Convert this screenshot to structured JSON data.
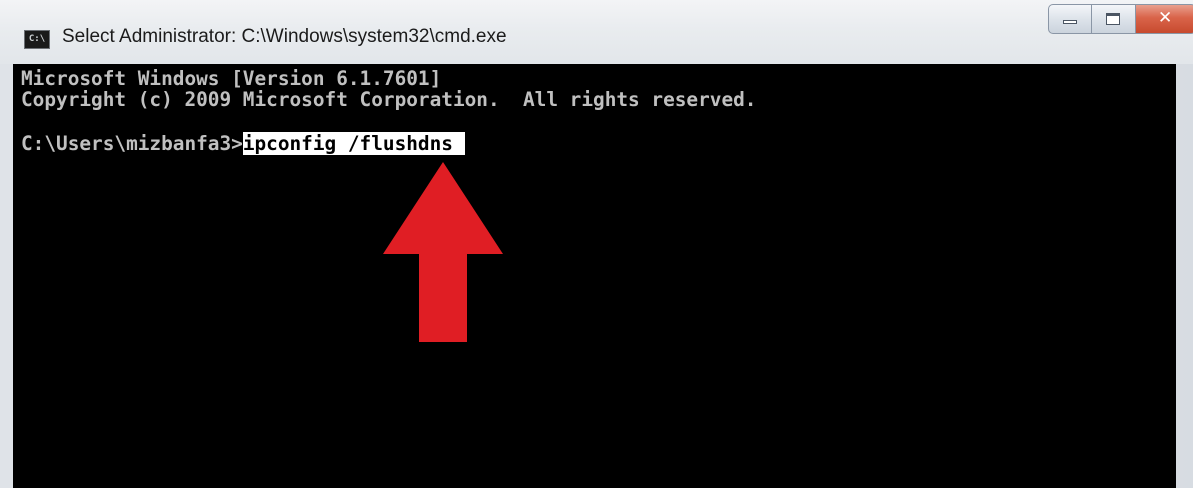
{
  "window": {
    "title": "Select Administrator: C:\\Windows\\system32\\cmd.exe",
    "app_icon": "cmd-icon",
    "app_icon_text": "C:\\"
  },
  "caption_buttons": {
    "minimize": "minimize-icon",
    "maximize": "maximize-icon",
    "close": "close-icon"
  },
  "console": {
    "lines": [
      "Microsoft Windows [Version 6.1.7601]",
      "Copyright (c) 2009 Microsoft Corporation.  All rights reserved."
    ],
    "prompt": "C:\\Users\\mizbanfa3>",
    "command": "ipconfig /flushdns",
    "text_color": "#c0c0c0",
    "background_color": "#000000"
  },
  "annotation": {
    "icon": "red-arrow-up-icon",
    "color": "#e01e24"
  }
}
